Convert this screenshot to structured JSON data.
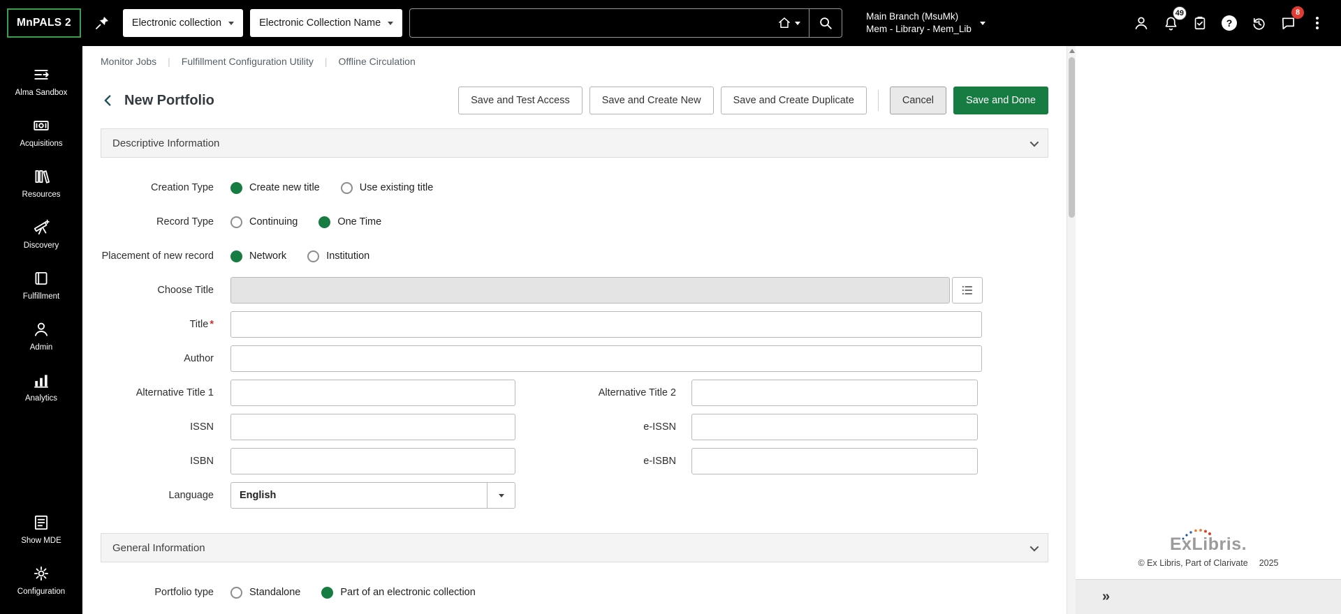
{
  "icons": {
    "expand": "»",
    "help": "?"
  },
  "topbar": {
    "logo": "MnPALS 2",
    "scope_dropdown": "Electronic collection",
    "name_dropdown": "Electronic Collection Name",
    "search_value": "",
    "location": {
      "line1": "Main Branch (MsuMk)",
      "line2": "Mem - Library - Mem_Lib"
    },
    "notifications_badge": "49",
    "chat_badge": "8"
  },
  "sidebar": {
    "items": [
      {
        "label": "Alma Sandbox"
      },
      {
        "label": "Acquisitions"
      },
      {
        "label": "Resources"
      },
      {
        "label": "Discovery"
      },
      {
        "label": "Fulfillment"
      },
      {
        "label": "Admin"
      },
      {
        "label": "Analytics"
      },
      {
        "label": "Show MDE"
      },
      {
        "label": "Configuration"
      }
    ]
  },
  "breadcrumb": {
    "items": [
      {
        "label": "Monitor Jobs"
      },
      {
        "label": "Fulfillment Configuration Utility"
      },
      {
        "label": "Offline Circulation"
      }
    ]
  },
  "page": {
    "title": "New Portfolio",
    "actions": {
      "save_test": "Save and Test Access",
      "save_new": "Save and Create New",
      "save_dup": "Save and Create Duplicate",
      "cancel": "Cancel",
      "save_done": "Save and Done"
    }
  },
  "descriptive": {
    "title": "Descriptive Information",
    "fields": {
      "creation_type": {
        "label": "Creation Type",
        "options": [
          {
            "label": "Create new title",
            "selected": true
          },
          {
            "label": "Use existing title",
            "selected": false
          }
        ]
      },
      "record_type": {
        "label": "Record Type",
        "options": [
          {
            "label": "Continuing",
            "selected": false
          },
          {
            "label": "One Time",
            "selected": true
          }
        ]
      },
      "placement": {
        "label": "Placement of new record",
        "options": [
          {
            "label": "Network",
            "selected": true
          },
          {
            "label": "Institution",
            "selected": false
          }
        ]
      },
      "choose_title": {
        "label": "Choose Title",
        "value": ""
      },
      "title": {
        "label": "Title",
        "required_mark": "*",
        "value": ""
      },
      "author": {
        "label": "Author",
        "value": ""
      },
      "alt_title_1": {
        "label": "Alternative Title 1",
        "value": ""
      },
      "alt_title_2": {
        "label": "Alternative Title 2",
        "value": ""
      },
      "issn": {
        "label": "ISSN",
        "value": ""
      },
      "eissn": {
        "label": "e-ISSN",
        "value": ""
      },
      "isbn": {
        "label": "ISBN",
        "value": ""
      },
      "eisbn": {
        "label": "e-ISBN",
        "value": ""
      },
      "language": {
        "label": "Language",
        "value": "English"
      }
    }
  },
  "general": {
    "title": "General Information",
    "fields": {
      "portfolio_type": {
        "label": "Portfolio type",
        "options": [
          {
            "label": "Standalone",
            "selected": false
          },
          {
            "label": "Part of an electronic collection",
            "selected": true
          }
        ]
      }
    }
  },
  "footer": {
    "logo_text": "ExLibris.",
    "copyright": "© Ex Libris, Part of Clarivate",
    "year": "2025"
  }
}
